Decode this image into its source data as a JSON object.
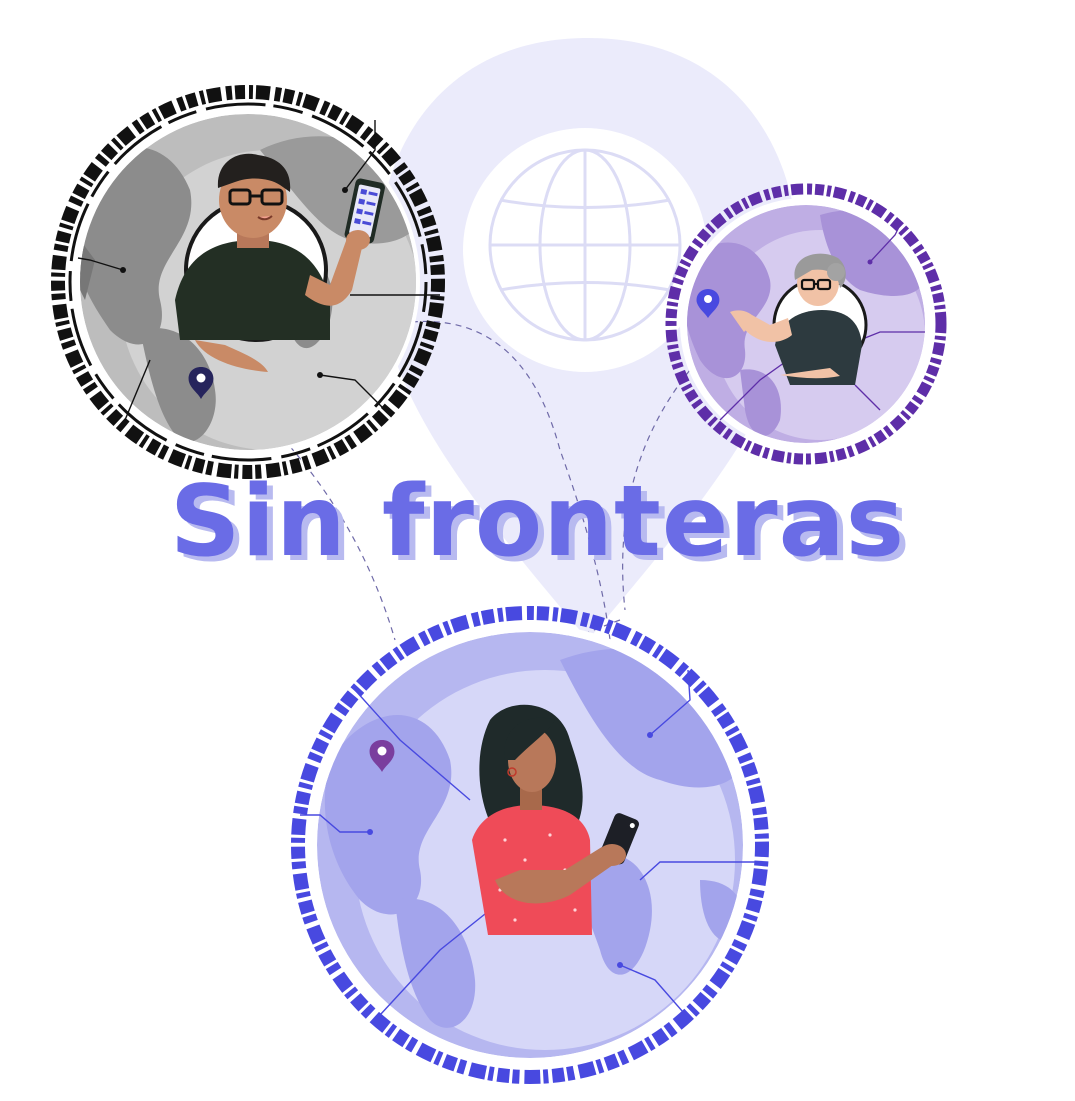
{
  "headline": {
    "text": "Sin fronteras"
  },
  "colors": {
    "background": "#ffffff",
    "pin_bg": "#ebebfb",
    "title": "#6a6ce6",
    "title_shadow": "#b8baf0",
    "ring_black": "#111111",
    "ring_purple": "#5e2ea8",
    "ring_blue": "#4849e0",
    "globe_gray": "#cfcfcf",
    "globe_lavender": "#cbbde9",
    "globe_blue": "#c9caf5",
    "skin": "#c98a66",
    "shirt_dark": "#232f24",
    "shirt_red": "#ef4b58",
    "shirt_black": "#2d3a3f"
  },
  "icons": [
    "map-pin-icon",
    "globe-icon",
    "smartphone-icon",
    "tablet-icon"
  ]
}
